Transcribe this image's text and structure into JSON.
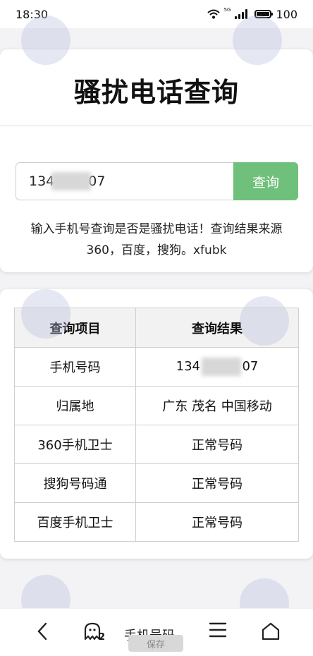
{
  "status_bar": {
    "time": "18:30",
    "network_label": "5G",
    "battery": "100"
  },
  "header": {
    "title": "骚扰电话查询"
  },
  "search": {
    "input_prefix": "134",
    "input_suffix": "07",
    "button_label": "查询"
  },
  "description": {
    "line1": "输入手机号查询是否是骚扰电话！查询结果来源",
    "line2": "360，百度，搜狗。xfubk"
  },
  "result_table": {
    "headers": [
      "查询项目",
      "查询结果"
    ],
    "rows": [
      {
        "item": "手机号码",
        "result_prefix": "134",
        "result_suffix": "07"
      },
      {
        "item": "归属地",
        "result": "广东 茂名 中国移动"
      },
      {
        "item": "360手机卫士",
        "result": "正常号码"
      },
      {
        "item": "搜狗号码通",
        "result": "正常号码"
      },
      {
        "item": "百度手机卫士",
        "result": "正常号码"
      }
    ]
  },
  "bottom_nav": {
    "tab_count": "2",
    "page_title": "手机号码..",
    "save_label": "保存"
  },
  "colors": {
    "accent_button": "#6fc07a",
    "text": "#111111"
  }
}
